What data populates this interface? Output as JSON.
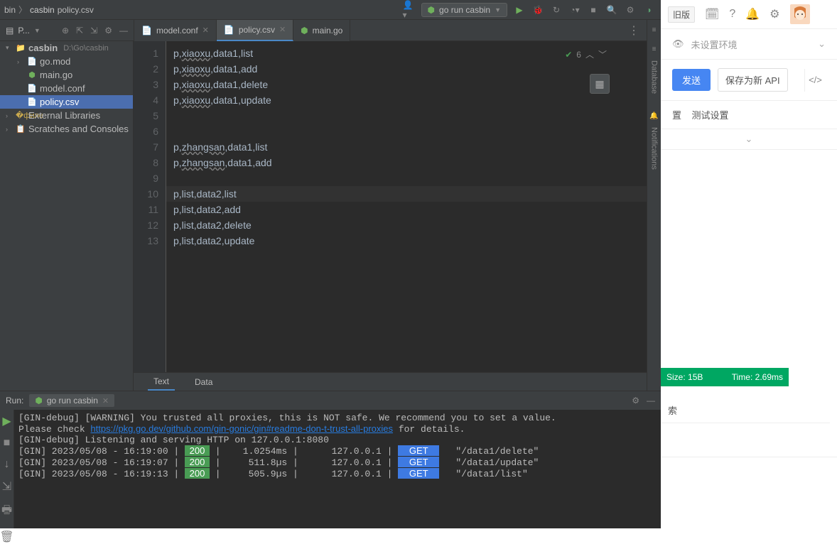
{
  "breadcrumb": {
    "root": "bin",
    "project": "casbin",
    "file": "policy.csv",
    "path": "D:\\Go\\casbin"
  },
  "run_config": {
    "label": "go run casbin"
  },
  "sidebar": {
    "tool_label": "P...",
    "items": [
      {
        "label": "casbin",
        "path": "D:\\Go\\casbin"
      },
      {
        "label": "go.mod"
      },
      {
        "label": "main.go"
      },
      {
        "label": "model.conf"
      },
      {
        "label": "policy.csv"
      },
      {
        "label": "External Libraries"
      },
      {
        "label": "Scratches and Consoles"
      }
    ]
  },
  "tabs": [
    {
      "label": "model.conf",
      "active": false
    },
    {
      "label": "policy.csv",
      "active": true
    },
    {
      "label": "main.go",
      "active": false
    }
  ],
  "editor": {
    "status_count": "6",
    "lines": [
      {
        "n": 1,
        "pre": "p,",
        "u": "xiaoxu",
        "post": ",data1,list"
      },
      {
        "n": 2,
        "pre": "p,",
        "u": "xiaoxu",
        "post": ",data1,add"
      },
      {
        "n": 3,
        "pre": "p,",
        "u": "xiaoxu",
        "post": ",data1,delete"
      },
      {
        "n": 4,
        "pre": "p,",
        "u": "xiaoxu",
        "post": ",data1,update"
      },
      {
        "n": 5,
        "pre": "",
        "u": "",
        "post": ""
      },
      {
        "n": 6,
        "pre": "",
        "u": "",
        "post": ""
      },
      {
        "n": 7,
        "pre": "p,",
        "u": "zhangsan",
        "post": ",data1,list"
      },
      {
        "n": 8,
        "pre": "p,",
        "u": "zhangsan",
        "post": ",data1,add"
      },
      {
        "n": 9,
        "pre": "",
        "u": "",
        "post": ""
      },
      {
        "n": 10,
        "pre": "p,list,data2,list",
        "u": "",
        "post": "",
        "hl": true
      },
      {
        "n": 11,
        "pre": "p,list,data2,add",
        "u": "",
        "post": ""
      },
      {
        "n": 12,
        "pre": "p,list,data2,delete",
        "u": "",
        "post": ""
      },
      {
        "n": 13,
        "pre": "p,list,data2,update",
        "u": "",
        "post": ""
      }
    ]
  },
  "footer_tabs": {
    "text": "Text",
    "data": "Data"
  },
  "right_rail": {
    "db": "Database",
    "notif": "Notifications"
  },
  "run_panel": {
    "label": "Run:",
    "tab": "go run casbin",
    "lines": {
      "warn": "[GIN-debug] [WARNING] You trusted all proxies, this is NOT safe. We recommend you to set a value.",
      "check_pre": "Please check ",
      "link": "https://pkg.go.dev/github.com/gin-gonic/gin#readme-don-t-trust-all-proxies",
      "check_post": " for details.",
      "listen": "[GIN-debug] Listening and serving HTTP on 127.0.0.1:8080",
      "log1": {
        "ts": "[GIN] 2023/05/08 - 16:19:00",
        "code": "200",
        "dur": "1.0254ms",
        "ip": "127.0.0.1",
        "method": "GET",
        "path": "\"/data1/delete\""
      },
      "log2": {
        "ts": "[GIN] 2023/05/08 - 16:19:07",
        "code": "200",
        "dur": "511.8µs",
        "ip": "127.0.0.1",
        "method": "GET",
        "path": "\"/data1/update\""
      },
      "log3": {
        "ts": "[GIN] 2023/05/08 - 16:19:13",
        "code": "200",
        "dur": "505.9µs",
        "ip": "127.0.0.1",
        "method": "GET",
        "path": "\"/data1/list\""
      }
    }
  },
  "api_panel": {
    "old_ver": "旧版",
    "env_placeholder": "未设置环境",
    "send": "发送",
    "save_api": "保存为新 API",
    "section1": "置",
    "section2": "测试设置",
    "search": "索",
    "status_size_label": "Size:",
    "status_size": "15B",
    "status_time_label": "Time:",
    "status_time": "2.69ms"
  }
}
